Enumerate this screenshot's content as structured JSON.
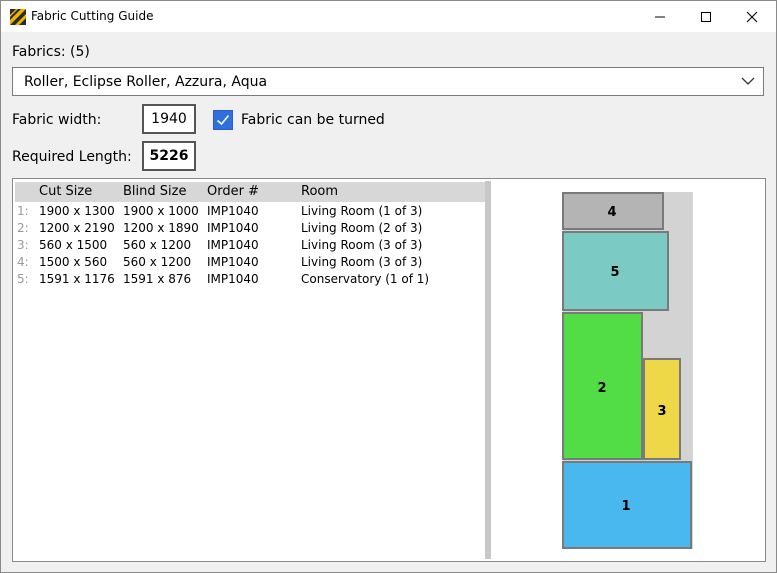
{
  "window": {
    "title": "Fabric Cutting Guide"
  },
  "fabrics": {
    "label": "Fabrics: (5)",
    "selected": "Roller, Eclipse Roller, Azzura, Aqua"
  },
  "fabric_width": {
    "label": "Fabric width:",
    "value": "1940"
  },
  "turnable": {
    "label": "Fabric can be turned",
    "checked": true
  },
  "required_length": {
    "label": "Required Length:",
    "value": "5226"
  },
  "list": {
    "columns": [
      "Cut Size",
      "Blind Size",
      "Order #",
      "Room"
    ],
    "rows": [
      {
        "num": "1:",
        "cut": "1900 x 1300",
        "blind": "1900 x 1000",
        "order": "IMP1040",
        "room": "Living Room (1 of  3)"
      },
      {
        "num": "2:",
        "cut": "1200 x 2190",
        "blind": "1200 x 1890",
        "order": "IMP1040",
        "room": "Living Room (2 of  3)"
      },
      {
        "num": "3:",
        "cut": "560 x 1500",
        "blind": "560 x 1200",
        "order": "IMP1040",
        "room": "Living Room (3 of  3)"
      },
      {
        "num": "4:",
        "cut": "1500 x 560",
        "blind": "560 x 1200",
        "order": "IMP1040",
        "room": "Living Room (3 of  3)"
      },
      {
        "num": "5:",
        "cut": "1591 x 1176",
        "blind": "1591 x 876",
        "order": "IMP1040",
        "room": "Conservatory (1 of  1)"
      }
    ]
  },
  "layout": {
    "pieces": [
      {
        "label": "4",
        "color": "#b4b4b4"
      },
      {
        "label": "5",
        "color": "#7ccac4"
      },
      {
        "label": "2",
        "color": "#52dc46"
      },
      {
        "label": "3",
        "color": "#eed848"
      },
      {
        "label": "1",
        "color": "#48b8ee"
      }
    ]
  },
  "colors": {
    "accent": "#2f6fe0",
    "fabric_background": "#d3d3d3"
  }
}
